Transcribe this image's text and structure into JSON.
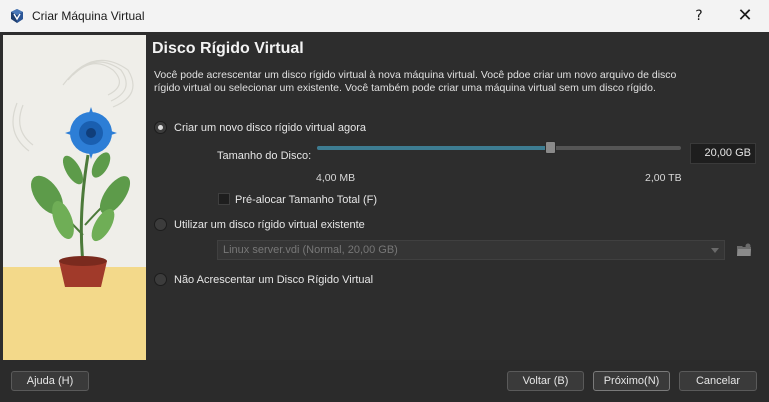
{
  "window": {
    "title": "Criar Máquina Virtual",
    "help_glyph": "?",
    "close_glyph": "✕"
  },
  "page": {
    "heading": "Disco Rígido Virtual",
    "description": "Você pode acrescentar um disco rígido virtual à nova máquina virtual. Você pdoe criar um novo arquivo de disco rígido virtual ou selecionar um existente. Você também pode criar uma máquina virtual sem um disco rígido."
  },
  "options": {
    "create_new": "Criar um novo disco rígido virtual agora",
    "use_existing": "Utilizar um disco rígido virtual existente",
    "no_disk": "Não Acrescentar um Disco Rígido Virtual",
    "selected": "create_new"
  },
  "disk_size": {
    "label": "Tamanho do Disco:",
    "value": "20,00 GB",
    "min_label": "4,00 MB",
    "max_label": "2,00 TB",
    "slider_fraction": 0.64
  },
  "preallocate": {
    "label": "Pré-alocar Tamanho Total (F)",
    "checked": false
  },
  "existing_disk": {
    "selected": "Linux server.vdi (Normal, 20,00 GB)",
    "enabled": false
  },
  "buttons": {
    "help": "Ajuda (H)",
    "back": "Voltar (B)",
    "next": "Próximo(N)",
    "cancel": "Cancelar"
  },
  "colors": {
    "accent": "#3d7c91",
    "background": "#2d2d2d",
    "titlebar": "#f3f3f3"
  },
  "icons": {
    "app": "virtualbox-icon",
    "folder": "folder-browse-icon"
  }
}
